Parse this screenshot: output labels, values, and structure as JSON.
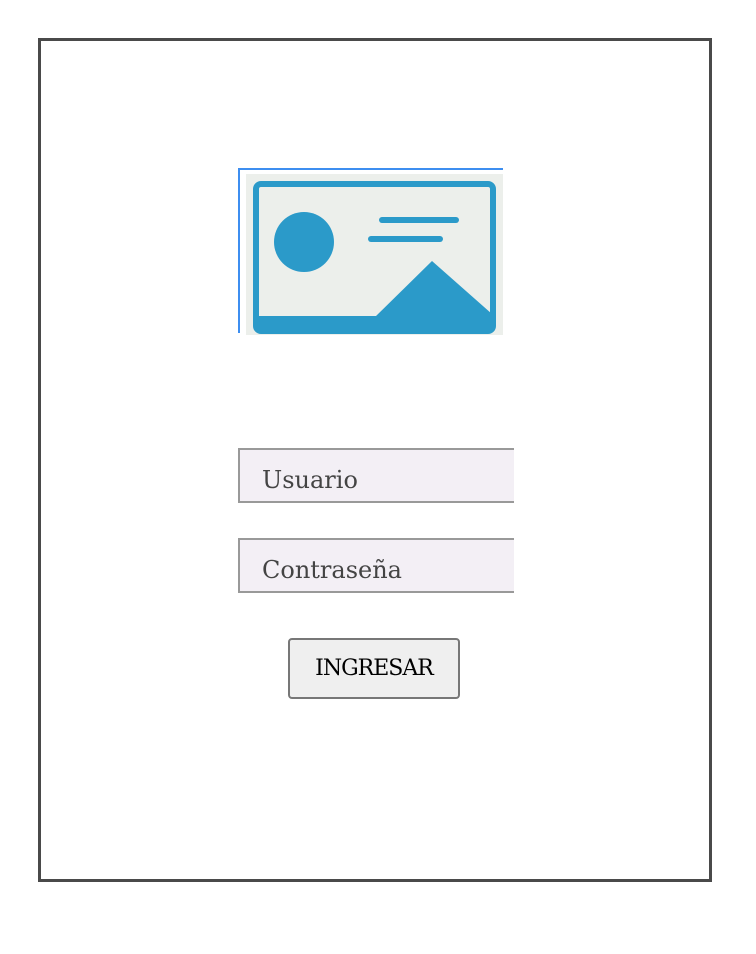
{
  "logo": {
    "icon": "image-placeholder-icon",
    "color": "#2b9ac9"
  },
  "form": {
    "username_placeholder": "Usuario",
    "username_value": "",
    "password_placeholder": "Contraseña",
    "password_value": "",
    "submit_label": "INGRESAR"
  }
}
